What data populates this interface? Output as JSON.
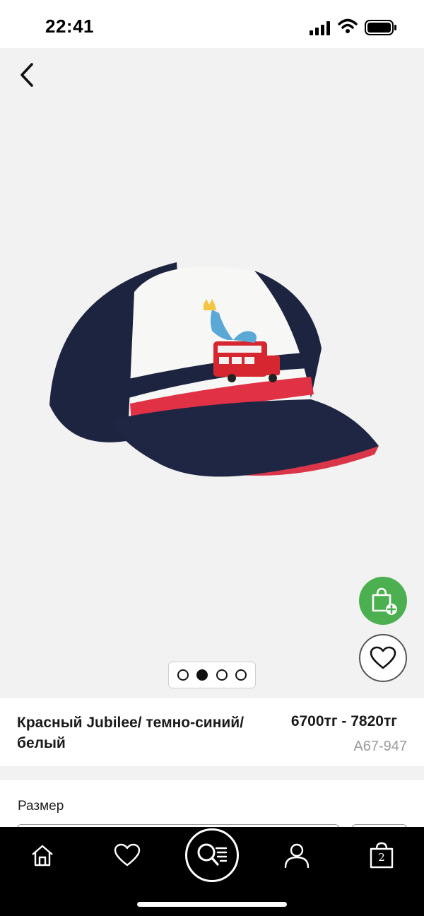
{
  "status_bar": {
    "time": "22:41",
    "icons": [
      "signal-icon",
      "wifi-icon",
      "battery-icon"
    ]
  },
  "gallery": {
    "back_icon": "chevron-left-icon",
    "image": "baseball-cap-with-red-bus-embroidery",
    "add_to_bag_icon": "bag-plus-icon",
    "add_to_bag_color": "#4caf50",
    "wishlist_icon": "heart-icon",
    "pager": {
      "total": 4,
      "active_index": 1
    }
  },
  "product": {
    "name": "Красный Jubilee/ темно-синий/белый",
    "price": "6700тг - 7820тг",
    "code": "A67-947"
  },
  "size": {
    "label": "Размер"
  },
  "bottom_nav": {
    "items": [
      {
        "icon": "home-icon"
      },
      {
        "icon": "heart-icon"
      },
      {
        "icon": "search-list-icon"
      },
      {
        "icon": "profile-icon"
      },
      {
        "icon": "bag-icon",
        "count": "2"
      }
    ]
  }
}
